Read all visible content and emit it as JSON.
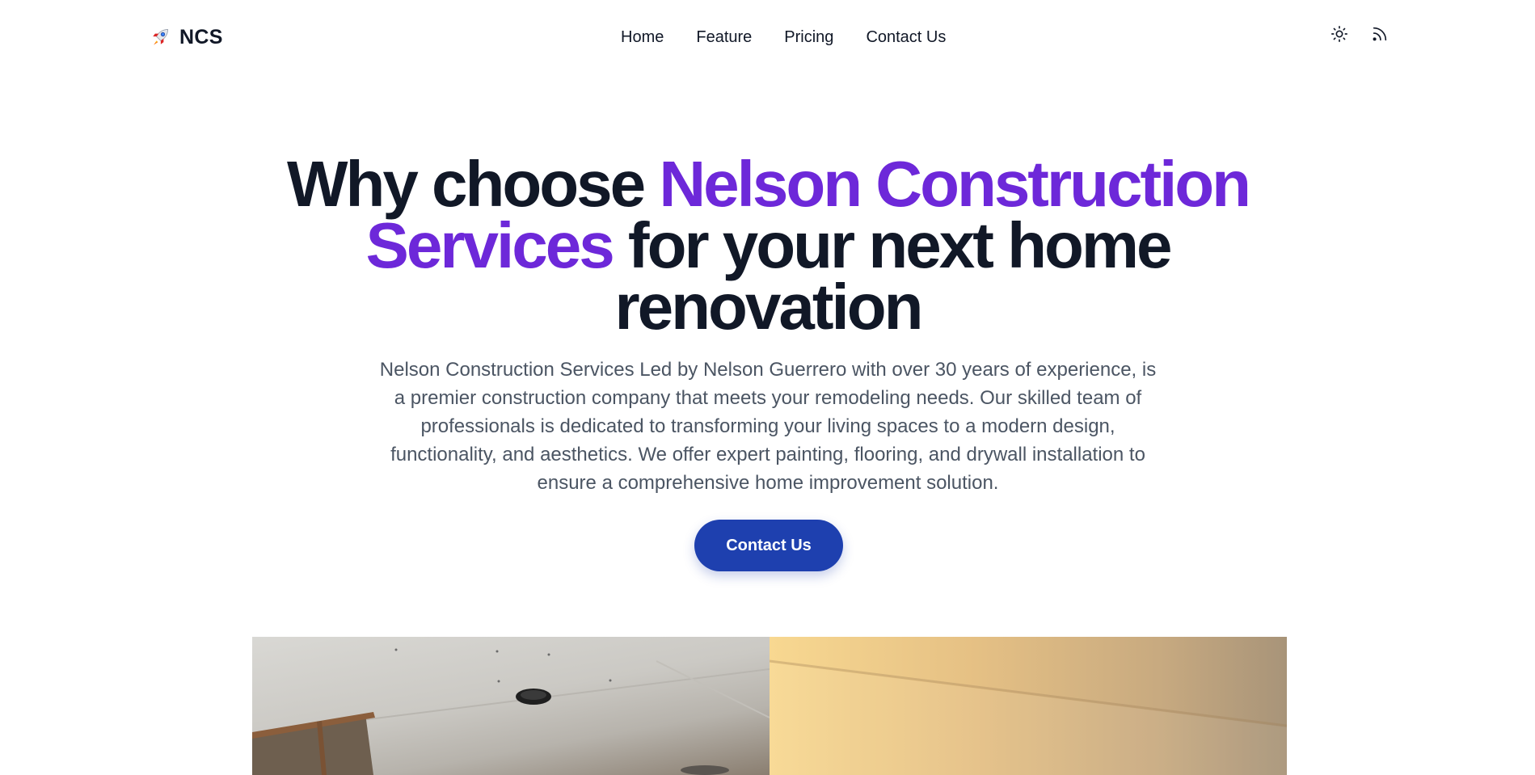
{
  "header": {
    "brand": "NCS",
    "nav": [
      "Home",
      "Feature",
      "Pricing",
      "Contact Us"
    ],
    "icons": [
      "sun-icon",
      "rss-icon"
    ]
  },
  "hero": {
    "title_part1": "Why choose ",
    "title_accent": "Nelson Construction Services",
    "title_part2": " for your next home renovation",
    "description": "Nelson Construction Services Led by Nelson Guerrero with over 30 years of experience, is a premier construction company that meets your remodeling needs. Our skilled team of professionals is dedicated to transforming your living spaces to a modern design, functionality, and aesthetics. We offer expert painting, flooring, and drywall installation to ensure a comprehensive home improvement solution.",
    "cta_label": "Contact Us"
  },
  "colors": {
    "accent": "#6d28d9",
    "button": "#1e40af",
    "text": "#111827",
    "muted": "#4b5563"
  }
}
